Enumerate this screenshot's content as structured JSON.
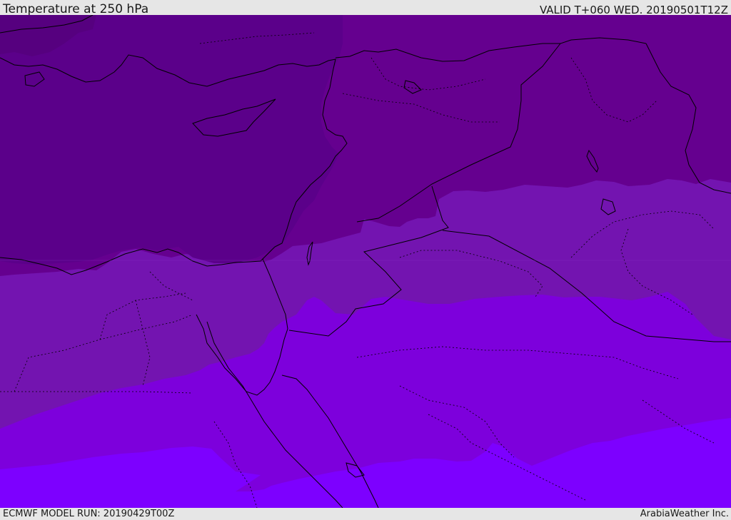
{
  "header": {
    "title": "Temperature at 250 hPa",
    "valid": "VALID T+060 WED. 20190501T12Z"
  },
  "footer": {
    "model_run": "ECMWF MODEL RUN: 20190429T00Z",
    "credit": "ArabiaWeather Inc."
  },
  "colors": {
    "band_coldest": "#5b008a",
    "band_cold": "#65008f",
    "band_mid": "#7314b0",
    "band_warm": "#7d00dc",
    "band_warmest": "#7d00ff",
    "coastline": "#000000",
    "border": "#000000"
  }
}
